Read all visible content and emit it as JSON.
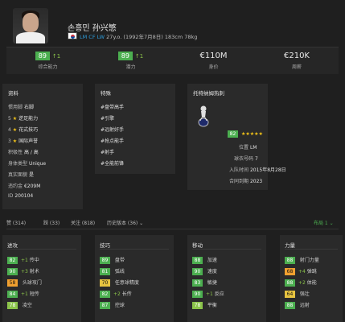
{
  "player": {
    "name": "손흥민 孙兴慜",
    "positions": "LM CF LW",
    "info": "27y.o. (1992年7月8日) 183cm 78kg"
  },
  "summary": [
    {
      "value": "89",
      "delta": "↑1",
      "label": "综合能力"
    },
    {
      "value": "89",
      "delta": "↑1",
      "label": "潜力"
    },
    {
      "value": "€110M",
      "label": "身价"
    },
    {
      "value": "€210K",
      "label": "周薪"
    }
  ],
  "profile": {
    "title": "资料",
    "rows": [
      {
        "label": "惯用脚",
        "value": "右脚"
      },
      {
        "label": "5",
        "value": "逆足能力",
        "star": true
      },
      {
        "label": "4",
        "value": "花式技巧",
        "star": true
      },
      {
        "label": "3",
        "value": "国际声誉",
        "star": true
      },
      {
        "label": "积极性",
        "value": "高 / 高"
      },
      {
        "label": "身体类型",
        "value": "Unique"
      },
      {
        "label": "真实面貌",
        "value": "是"
      },
      {
        "label": "违约金",
        "value": "€209M"
      },
      {
        "label": "ID",
        "value": "200104"
      }
    ]
  },
  "traits": {
    "title": "特殊",
    "items": [
      "#盘带高手",
      "#引擎",
      "#远射好手",
      "#抢点能手",
      "#射手",
      "#全能前锋"
    ]
  },
  "club": {
    "title": "托特纳姆热刺",
    "rating": "82",
    "stars": "★★★★★",
    "rows": [
      {
        "label": "位置",
        "value": "LM"
      },
      {
        "label": "球衣号码",
        "value": "7"
      },
      {
        "label": "入队时间",
        "value": "2015年8月28日"
      },
      {
        "label": "合同到期",
        "value": "2023"
      }
    ]
  },
  "tabs": {
    "items": [
      "赞 (314)",
      "踩 (33)",
      "关注 (818)",
      "历史版本 (36) ⌄"
    ],
    "right": "布局 1 ⌄"
  },
  "attributes": [
    {
      "title": "进攻",
      "rows": [
        {
          "v": "82",
          "c": "g",
          "inc": "+1",
          "name": "传中"
        },
        {
          "v": "90",
          "c": "g",
          "inc": "+3",
          "name": "射术"
        },
        {
          "v": "58",
          "c": "o",
          "inc": "",
          "name": "头球攻门"
        },
        {
          "v": "84",
          "c": "g",
          "inc": "+1",
          "name": "短传"
        },
        {
          "v": "78",
          "c": "lg",
          "inc": "",
          "name": "凌空"
        }
      ]
    },
    {
      "title": "技巧",
      "rows": [
        {
          "v": "89",
          "c": "g",
          "inc": "",
          "name": "盘带"
        },
        {
          "v": "81",
          "c": "g",
          "inc": "",
          "name": "弧线"
        },
        {
          "v": "70",
          "c": "y",
          "inc": "",
          "name": "任意球精度"
        },
        {
          "v": "82",
          "c": "g",
          "inc": "+2",
          "name": "长传"
        },
        {
          "v": "87",
          "c": "g",
          "inc": "",
          "name": "控球"
        }
      ]
    },
    {
      "title": "移动",
      "rows": [
        {
          "v": "88",
          "c": "g",
          "inc": "",
          "name": "加速"
        },
        {
          "v": "90",
          "c": "g",
          "inc": "",
          "name": "速度"
        },
        {
          "v": "83",
          "c": "g",
          "inc": "",
          "name": "敏捷"
        },
        {
          "v": "90",
          "c": "g",
          "inc": "+1",
          "name": "反应"
        },
        {
          "v": "78",
          "c": "lg",
          "inc": "",
          "name": "平衡"
        }
      ]
    },
    {
      "title": "力量",
      "rows": [
        {
          "v": "88",
          "c": "g",
          "inc": "",
          "name": "射门力量"
        },
        {
          "v": "68",
          "c": "o",
          "inc": "+4",
          "name": "弹跳"
        },
        {
          "v": "88",
          "c": "g",
          "inc": "+2",
          "name": "体能"
        },
        {
          "v": "64",
          "c": "y",
          "inc": "",
          "name": "强壮"
        },
        {
          "v": "88",
          "c": "g",
          "inc": "",
          "name": "远射"
        }
      ]
    }
  ]
}
